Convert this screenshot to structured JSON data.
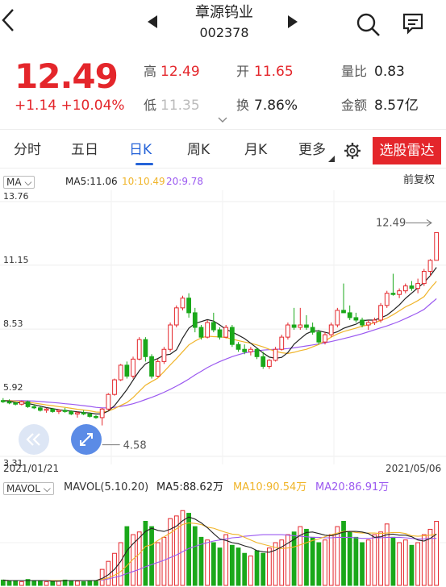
{
  "header": {
    "title": "章源钨业",
    "code": "002378",
    "back_icon": "chevron-left-icon",
    "prev_icon": "triangle-left-icon",
    "next_icon": "triangle-right-icon"
  },
  "quote": {
    "price": "12.49",
    "change": "+1.14 +10.04%",
    "high_label": "高",
    "high": "12.49",
    "open_label": "开",
    "open": "11.65",
    "volume_ratio_label": "量比",
    "volume_ratio": "0.83",
    "low_label": "低",
    "low": "11.35",
    "turnover_label": "换",
    "turnover": "7.86%",
    "amount_label": "金额",
    "amount": "8.57亿"
  },
  "tabs": [
    {
      "label": "分时"
    },
    {
      "label": "五日"
    },
    {
      "label": "日K"
    },
    {
      "label": "周K"
    },
    {
      "label": "月K"
    },
    {
      "label": "更多"
    }
  ],
  "select_button": "选股雷达",
  "ma_header": {
    "dropdown": "MA",
    "ma5": "MA5:11.06",
    "ma10": "10:10.49",
    "ma20": "20:9.78",
    "adjust": "前复权"
  },
  "price_axis": {
    "labels": [
      "13.76",
      "11.15",
      "8.53",
      "5.92",
      "3.31"
    ],
    "high_marker": "12.49",
    "low_marker": "4.58",
    "start_date": "2021/01/21",
    "end_date": "2021/05/06"
  },
  "vol_header": {
    "dropdown": "MAVOL",
    "title": "MAVOL(5.10.20)",
    "ma5": "MA5:88.62万",
    "ma10": "MA10:90.54万",
    "ma20": "MA20:86.91万"
  },
  "colors": {
    "up": "#e4262b",
    "down": "#1aa81a",
    "ma5": "#222222",
    "ma10": "#f0b429",
    "ma20": "#9b59f0",
    "accent": "#2563d8"
  },
  "chart_data": {
    "type": "candlestick",
    "ylim": [
      3.31,
      13.76
    ],
    "candles": [
      [
        5.6,
        5.7,
        5.5,
        5.55
      ],
      [
        5.55,
        5.65,
        5.45,
        5.5
      ],
      [
        5.5,
        5.55,
        5.4,
        5.45
      ],
      [
        5.45,
        5.6,
        5.4,
        5.55
      ],
      [
        5.55,
        5.6,
        5.3,
        5.35
      ],
      [
        5.35,
        5.45,
        5.25,
        5.3
      ],
      [
        5.3,
        5.35,
        5.15,
        5.2
      ],
      [
        5.2,
        5.3,
        5.1,
        5.25
      ],
      [
        5.25,
        5.3,
        5.1,
        5.15
      ],
      [
        5.15,
        5.25,
        5.05,
        5.2
      ],
      [
        5.2,
        5.3,
        5.1,
        5.15
      ],
      [
        5.15,
        5.2,
        5.0,
        5.05
      ],
      [
        5.05,
        5.15,
        4.9,
        5.1
      ],
      [
        5.1,
        5.2,
        5.0,
        5.05
      ],
      [
        5.05,
        5.1,
        4.9,
        4.95
      ],
      [
        4.95,
        5.0,
        4.85,
        4.9
      ],
      [
        4.9,
        5.3,
        4.58,
        5.25
      ],
      [
        5.25,
        5.9,
        5.2,
        5.85
      ],
      [
        5.85,
        6.5,
        5.8,
        6.45
      ],
      [
        6.45,
        7.1,
        6.4,
        7.05
      ],
      [
        7.05,
        7.2,
        6.5,
        6.6
      ],
      [
        6.6,
        7.4,
        6.5,
        7.3
      ],
      [
        7.3,
        8.2,
        7.25,
        8.1
      ],
      [
        8.1,
        8.2,
        7.2,
        7.4
      ],
      [
        7.4,
        7.5,
        6.5,
        6.6
      ],
      [
        6.6,
        7.3,
        6.55,
        7.2
      ],
      [
        7.2,
        7.8,
        7.1,
        7.7
      ],
      [
        7.7,
        8.8,
        7.6,
        8.7
      ],
      [
        8.7,
        9.5,
        8.6,
        9.4
      ],
      [
        9.4,
        9.9,
        9.3,
        9.8
      ],
      [
        9.8,
        10.0,
        9.0,
        9.2
      ],
      [
        9.2,
        9.4,
        8.4,
        8.6
      ],
      [
        8.6,
        8.7,
        8.1,
        8.2
      ],
      [
        8.2,
        8.9,
        8.15,
        8.8
      ],
      [
        8.8,
        9.2,
        8.4,
        8.5
      ],
      [
        8.5,
        8.6,
        8.1,
        8.2
      ],
      [
        8.2,
        8.7,
        8.15,
        8.6
      ],
      [
        8.6,
        8.7,
        7.8,
        7.9
      ],
      [
        7.9,
        8.0,
        7.6,
        7.7
      ],
      [
        7.7,
        7.9,
        7.5,
        7.6
      ],
      [
        7.6,
        7.8,
        7.45,
        7.7
      ],
      [
        7.7,
        7.75,
        7.3,
        7.4
      ],
      [
        7.4,
        7.6,
        6.9,
        7.0
      ],
      [
        7.0,
        7.3,
        6.9,
        7.25
      ],
      [
        7.25,
        7.8,
        7.2,
        7.7
      ],
      [
        7.7,
        8.3,
        7.65,
        8.2
      ],
      [
        8.2,
        8.8,
        8.1,
        8.7
      ],
      [
        8.7,
        9.4,
        8.5,
        8.6
      ],
      [
        8.6,
        9.4,
        8.5,
        8.7
      ],
      [
        8.7,
        9.1,
        8.5,
        8.6
      ],
      [
        8.6,
        8.8,
        8.3,
        8.4
      ],
      [
        8.4,
        8.5,
        7.9,
        8.0
      ],
      [
        8.0,
        8.4,
        7.9,
        8.3
      ],
      [
        8.3,
        8.8,
        8.2,
        8.7
      ],
      [
        8.7,
        9.4,
        8.6,
        9.3
      ],
      [
        9.3,
        10.4,
        9.2,
        9.2
      ],
      [
        9.2,
        9.5,
        8.9,
        9.0
      ],
      [
        9.0,
        9.2,
        8.8,
        8.9
      ],
      [
        8.9,
        9.0,
        8.6,
        8.7
      ],
      [
        8.7,
        8.9,
        8.5,
        8.8
      ],
      [
        8.8,
        9.0,
        8.7,
        8.9
      ],
      [
        8.9,
        9.6,
        8.8,
        9.5
      ],
      [
        9.5,
        10.1,
        9.4,
        10.0
      ],
      [
        10.0,
        10.8,
        9.9,
        9.95
      ],
      [
        9.95,
        10.2,
        9.8,
        10.1
      ],
      [
        10.1,
        10.4,
        10.0,
        10.3
      ],
      [
        10.3,
        10.5,
        10.1,
        10.2
      ],
      [
        10.2,
        10.6,
        10.0,
        10.4
      ],
      [
        10.4,
        11.0,
        10.3,
        10.9
      ],
      [
        10.9,
        11.4,
        10.7,
        11.35
      ],
      [
        11.35,
        12.49,
        11.35,
        12.49
      ]
    ],
    "ma5": [
      5.6,
      5.58,
      5.52,
      5.5,
      5.48,
      5.43,
      5.37,
      5.31,
      5.27,
      5.22,
      5.19,
      5.17,
      5.14,
      5.11,
      5.09,
      5.05,
      5.05,
      5.17,
      5.39,
      5.72,
      6.05,
      6.44,
      6.82,
      7.1,
      7.23,
      7.32,
      7.46,
      7.5,
      7.68,
      8.16,
      8.56,
      8.76,
      8.84,
      8.92,
      8.86,
      8.7,
      8.52,
      8.41,
      8.28,
      8.14,
      7.95,
      7.75,
      7.55,
      7.38,
      7.33,
      7.37,
      7.57,
      7.91,
      8.13,
      8.34,
      8.45,
      8.46,
      8.4,
      8.34,
      8.42,
      8.56,
      8.65,
      8.73,
      8.88,
      8.9,
      8.9,
      8.99,
      9.1,
      9.3,
      9.52,
      9.79,
      10.01,
      10.22,
      10.44,
      10.72,
      11.06
    ],
    "ma10": [
      5.6,
      5.6,
      5.58,
      5.56,
      5.53,
      5.5,
      5.46,
      5.42,
      5.39,
      5.35,
      5.32,
      5.28,
      5.24,
      5.21,
      5.18,
      5.13,
      5.12,
      5.17,
      5.27,
      5.4,
      5.52,
      5.72,
      5.98,
      6.23,
      6.38,
      6.52,
      6.79,
      7.06,
      7.32,
      7.6,
      7.88,
      8.04,
      8.17,
      8.24,
      8.22,
      8.21,
      8.18,
      8.12,
      8.06,
      8.0,
      7.95,
      7.88,
      7.8,
      7.7,
      7.62,
      7.56,
      7.53,
      7.58,
      7.65,
      7.7,
      7.8,
      7.9,
      8.05,
      8.2,
      8.33,
      8.43,
      8.5,
      8.57,
      8.65,
      8.7,
      8.8,
      8.88,
      8.98,
      9.12,
      9.28,
      9.44,
      9.56,
      9.7,
      9.86,
      10.2,
      10.49
    ],
    "ma20": [
      5.6,
      5.6,
      5.6,
      5.6,
      5.59,
      5.58,
      5.56,
      5.54,
      5.52,
      5.5,
      5.47,
      5.45,
      5.42,
      5.39,
      5.36,
      5.32,
      5.3,
      5.3,
      5.32,
      5.36,
      5.41,
      5.47,
      5.55,
      5.64,
      5.73,
      5.83,
      5.94,
      6.06,
      6.19,
      6.33,
      6.48,
      6.65,
      6.8,
      6.95,
      7.08,
      7.2,
      7.3,
      7.4,
      7.48,
      7.55,
      7.6,
      7.64,
      7.67,
      7.69,
      7.7,
      7.71,
      7.73,
      7.76,
      7.8,
      7.84,
      7.88,
      7.92,
      7.97,
      8.02,
      8.08,
      8.14,
      8.2,
      8.27,
      8.34,
      8.42,
      8.5,
      8.58,
      8.66,
      8.75,
      8.85,
      8.96,
      9.08,
      9.2,
      9.34,
      9.56,
      9.78
    ],
    "volume_ylim": [
      0,
      160
    ],
    "volumes": [
      10,
      8,
      9,
      7,
      11,
      9,
      8,
      7,
      9,
      8,
      10,
      9,
      8,
      7,
      9,
      8,
      30,
      45,
      60,
      80,
      110,
      95,
      100,
      120,
      110,
      80,
      90,
      125,
      130,
      140,
      135,
      110,
      90,
      85,
      80,
      70,
      95,
      75,
      70,
      60,
      55,
      65,
      60,
      70,
      80,
      85,
      95,
      100,
      110,
      105,
      90,
      80,
      85,
      95,
      110,
      120,
      100,
      90,
      80,
      85,
      95,
      100,
      115,
      90,
      80,
      85,
      75,
      80,
      95,
      105,
      120
    ],
    "vol_ma5": [
      10,
      9,
      9,
      9,
      9,
      9,
      9,
      9,
      8,
      8,
      9,
      9,
      9,
      9,
      9,
      9,
      13,
      20,
      30,
      45,
      65,
      78,
      89,
      101,
      107,
      103,
      101,
      105,
      111,
      121,
      128,
      124,
      117,
      108,
      97,
      87,
      84,
      80,
      78,
      74,
      71,
      65,
      63,
      62,
      66,
      72,
      79,
      86,
      94,
      99,
      100,
      97,
      94,
      93,
      96,
      100,
      101,
      101,
      100,
      97,
      90,
      91,
      95,
      96,
      94,
      94,
      91,
      85,
      83,
      88,
      96
    ],
    "vol_ma10": [
      10,
      9,
      9,
      9,
      9,
      9,
      9,
      9,
      9,
      9,
      9,
      9,
      9,
      9,
      9,
      9,
      11,
      14,
      19,
      26,
      37,
      49,
      59,
      73,
      76,
      84,
      91,
      98,
      106,
      114,
      117,
      116,
      114,
      109,
      107,
      103,
      99,
      96,
      95,
      90,
      85,
      80,
      77,
      74,
      71,
      69,
      70,
      72,
      76,
      80,
      84,
      87,
      91,
      95,
      98,
      101,
      101,
      99,
      98,
      98,
      98,
      97,
      98,
      99,
      99,
      97,
      93,
      92,
      93,
      94,
      96
    ],
    "vol_ma20": [
      10,
      9,
      9,
      9,
      9,
      9,
      9,
      9,
      9,
      9,
      9,
      9,
      9,
      9,
      9,
      9,
      10,
      12,
      15,
      18,
      22,
      26,
      30,
      35,
      39,
      43,
      47,
      52,
      57,
      63,
      69,
      73,
      77,
      80,
      83,
      85,
      87,
      89,
      90,
      92,
      93,
      94,
      95,
      95,
      95,
      95,
      94,
      93,
      92,
      91,
      90,
      90,
      89,
      89,
      90,
      90,
      90,
      89,
      88,
      88,
      89,
      89,
      90,
      90,
      90,
      89,
      88,
      87,
      87,
      88,
      88
    ]
  }
}
